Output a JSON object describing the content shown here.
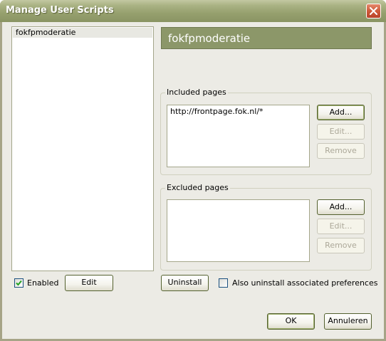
{
  "window": {
    "title": "Manage User Scripts"
  },
  "scripts": {
    "items": [
      {
        "label": "fokfpmoderatie",
        "selected": true
      }
    ]
  },
  "details": {
    "script_name": "fokfpmoderatie",
    "included": {
      "label": "Included pages",
      "items": [
        "http://frontpage.fok.nl/*"
      ],
      "add_label": "Add...",
      "edit_label": "Edit...",
      "remove_label": "Remove"
    },
    "excluded": {
      "label": "Excluded pages",
      "items": [],
      "add_label": "Add...",
      "edit_label": "Edit...",
      "remove_label": "Remove"
    }
  },
  "bottom": {
    "enabled_label": "Enabled",
    "enabled_checked": true,
    "edit_label": "Edit",
    "uninstall_label": "Uninstall",
    "uninstall_prefs_label": "Also uninstall associated preferences",
    "uninstall_prefs_checked": false
  },
  "dialog": {
    "ok_label": "OK",
    "cancel_label": "Annuleren"
  },
  "colors": {
    "titlebar": "#96a06e",
    "header_bar": "#8c9769",
    "face": "#ecebe5",
    "close_button": "#cf5a3a"
  }
}
